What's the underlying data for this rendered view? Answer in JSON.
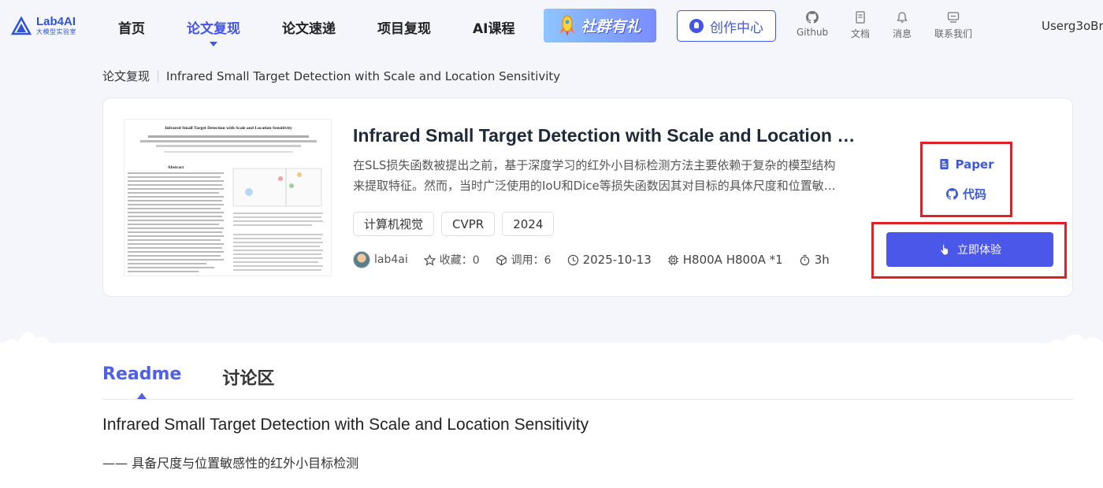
{
  "header": {
    "logo_name": "Lab4AI",
    "logo_sub": "大模型实验室",
    "nav": [
      {
        "label": "首页"
      },
      {
        "label": "论文复现"
      },
      {
        "label": "论文速递"
      },
      {
        "label": "项目复现"
      },
      {
        "label": "AI课程"
      }
    ],
    "promo_label": "社群有礼",
    "create_label": "创作中心",
    "links": [
      {
        "label": "Github",
        "icon": "github-icon"
      },
      {
        "label": "文档",
        "icon": "document-icon"
      },
      {
        "label": "消息",
        "icon": "bell-icon"
      },
      {
        "label": "联系我们",
        "icon": "chat-icon"
      }
    ],
    "user": "Userg3oBr"
  },
  "breadcrumb": {
    "parent": "论文复现",
    "current": "Infrared Small Target Detection with Scale and Location Sensitivity"
  },
  "card": {
    "title": "Infrared Small Target Detection with Scale and Location Sensitivity",
    "description": "在SLS损失函数被提出之前，基于深度学习的红外小目标检测方法主要依赖于复杂的模型结构来提取特征。然而，当时广泛使用的IoU和Dice等损失函数因其对目标的具体尺度和位置敏感性不足，导致检测性能受限。",
    "tags": [
      "计算机视觉",
      "CVPR",
      "2024"
    ],
    "meta": {
      "author": "lab4ai",
      "favorites": "收藏：0",
      "calls": "调用：6",
      "date": "2025-10-13",
      "gpu": "H800A H800A *1",
      "duration": "3h"
    },
    "links": {
      "paper": "Paper",
      "code": "代码"
    },
    "try_label": "立即体验",
    "thumbnail": {
      "title": "Infrared Small Target Detection with Scale and Location Sensitivity",
      "abstract_heading": "Abstract"
    }
  },
  "tabs": [
    {
      "label": "Readme"
    },
    {
      "label": "讨论区"
    }
  ],
  "readme": {
    "title": "Infrared Small Target Detection with Scale and Location Sensitivity",
    "subtitle": "—— 具备尺度与位置敏感性的红外小目标检测"
  },
  "colors": {
    "accent": "#4355e6",
    "highlight_box": "#e01f26"
  }
}
